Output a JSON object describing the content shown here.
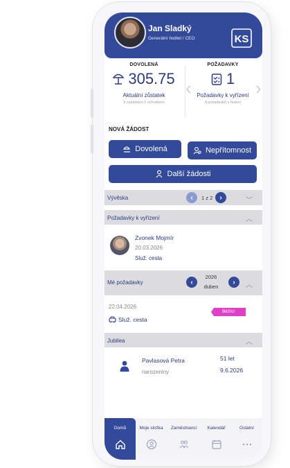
{
  "header": {
    "user_name": "Jan Sladký",
    "user_role": "Generální ředitel / CEO",
    "logo_text": "KS"
  },
  "vacation": {
    "title": "DOVOLENÁ",
    "value": "305.75",
    "label": "Aktuální zůstatek",
    "sub": "8 zažádáno 0 schváleno"
  },
  "requests": {
    "title": "POŽADAVKY",
    "value": "1",
    "label": "Požadavky k vyřízení",
    "sub": "8 požadavků v řešení"
  },
  "new_request": {
    "title": "NOVÁ ŽÁDOST",
    "vacation_btn": "Dovolená",
    "absence_btn": "Nepřítomnost",
    "other_btn": "Další žádosti"
  },
  "board": {
    "title": "Vývěska",
    "pager": "1 z 2"
  },
  "pending": {
    "title": "Požadavky k vyřízení",
    "name": "Zvonek Mojmír",
    "date": "20.03.2026",
    "type": "Služ. cesta"
  },
  "my_requests": {
    "title": "Mé požadavky",
    "year": "2026",
    "month": "duben",
    "date": "22.04.2026",
    "type": "Služ. cesta",
    "status": "Běžící"
  },
  "jubilee": {
    "title": "Jubilea",
    "name": "Pavlasová Petra",
    "event": "narozeniny",
    "years": "51 let",
    "date": "9.6.2026"
  },
  "tabs": [
    "Domů",
    "Moje složka",
    "Zaměstnanci",
    "Kalendář",
    "Ostatní"
  ],
  "colors": {
    "primary": "#33499a",
    "status_running": "#e040c8"
  }
}
